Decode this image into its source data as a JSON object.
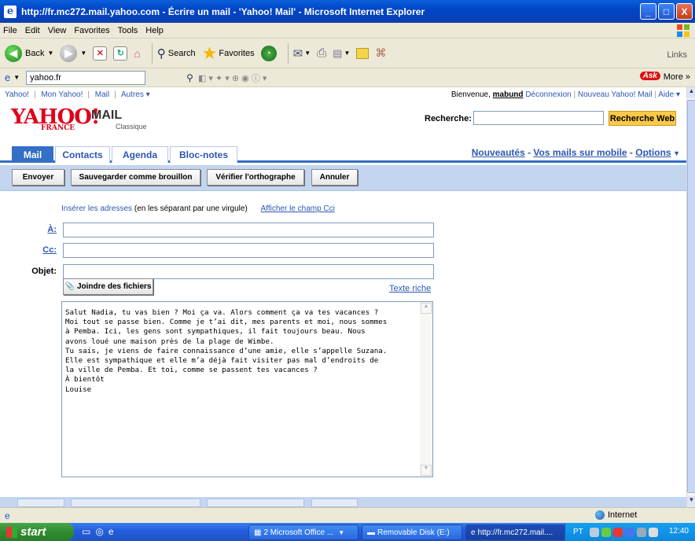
{
  "window": {
    "title": "http://fr.mc272.mail.yahoo.com - Écrire un mail - 'Yahoo! Mail' - Microsoft Internet Explorer",
    "buttons": [
      "_",
      "□",
      "X"
    ]
  },
  "menu": [
    "File",
    "Edit",
    "View",
    "Favorites",
    "Tools",
    "Help"
  ],
  "toolbar": {
    "back": "Back",
    "search": "Search",
    "favorites": "Favorites",
    "links": "Links"
  },
  "address": {
    "value": "yahoo.fr",
    "more": "More"
  },
  "yahoo": {
    "top_links": [
      "Yahoo!",
      "Mon Yahoo!",
      "Mail",
      "Autres ▾"
    ],
    "welcome_prefix": "Bienvenue, ",
    "username": "mabund",
    "deconnexion": "Déconnexion",
    "nouveau": "Nouveau Yahoo! Mail",
    "aide": "Aide ▾",
    "logo_text": "YAHOO!",
    "logo_france": "FRANCE",
    "logo_mail": "MAIL",
    "logo_classique": "Classique",
    "search_label": "Recherche:",
    "search_button": "Recherche Web"
  },
  "tabs": [
    "Mail",
    "Contacts",
    "Agenda",
    "Bloc-notes"
  ],
  "tab_right": {
    "nouveautes": "Nouveautés",
    "mobile": "Vos mails sur mobile",
    "options": "Options",
    "sep": " - "
  },
  "actions": [
    "Envoyer",
    "Sauvegarder comme brouillon",
    "Vérifier l'orthographe",
    "Annuler"
  ],
  "compose": {
    "hint_link": "Insérer les adresses",
    "hint_text": " (en les séparant par une virgule)",
    "cci_link": "Afficher le champ Cci",
    "to_label": "À:",
    "cc_label": "Cc:",
    "subject_label": "Objet:",
    "to_value": "",
    "cc_value": "",
    "subject_value": "",
    "attach": "Joindre des fichiers",
    "rich_text": "Texte riche",
    "body": "Salut Nadia, tu vas bien ? Moi ça va. Alors comment ça va tes vacances ?\nMoi tout se passe bien. Comme je t’ai dit, mes parents et moi, nous sommes\nà Pemba. Ici, les gens sont sympathiques, il fait toujours beau. Nous\navons loué une maison près de la plage de Wimbe.\nTu sais, je viens de faire connaissance d’une amie, elle s’appelle Suzana.\nElle est sympathique et elle m’a déjà fait visiter pas mal d’endroits de\nla ville de Pemba. Et toi, comme se passent tes vacances ?\nÀ bientôt\nLouise"
  },
  "status": {
    "zone": "Internet"
  },
  "taskbar": {
    "start": "start",
    "tasks": [
      "2 Microsoft Office ...",
      "Removable Disk (E:)",
      "http://fr.mc272.mail...."
    ],
    "lang": "PT",
    "clock": "12:40"
  },
  "colors": {
    "yahoo_red": "#e0001b",
    "tab_blue": "#336fc6",
    "link_blue": "#2d57b2",
    "search_yellow": "#fbc948"
  }
}
